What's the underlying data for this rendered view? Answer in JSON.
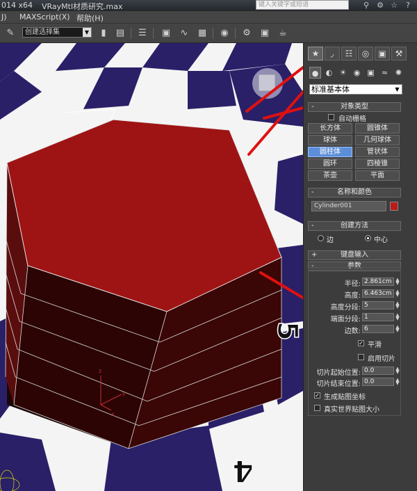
{
  "titlebar": {
    "version_text": "014 x64",
    "file_name": "VRayMtl材质研究.max",
    "search_placeholder": "键入关键字或短语",
    "icons": [
      "binoculars-icon",
      "key-icon",
      "star-icon",
      "help-icon"
    ]
  },
  "menubar": {
    "items": [
      "J)",
      "MAXScript(X)",
      "帮助(H)"
    ]
  },
  "toolbar": {
    "selection_set": "创建选择集",
    "icons": [
      "text-abc-icon",
      "mirror-icon",
      "align-icon",
      "layer-icon",
      "ribbon-icon",
      "curve-editor-icon",
      "schematic-icon",
      "material-editor-icon",
      "render-setup-icon",
      "render-frame-icon",
      "render-icon"
    ]
  },
  "panel": {
    "tabs": [
      "create-tab",
      "modify-tab",
      "hierarchy-tab",
      "motion-tab",
      "display-tab",
      "utilities-tab"
    ],
    "subtabs": [
      "geometry-icon",
      "shapes-icon",
      "lights-icon",
      "cameras-icon",
      "helpers-icon",
      "spacewarps-icon",
      "systems-icon"
    ],
    "primitive_type": "标准基本体",
    "object_type": {
      "title": "对象类型",
      "autogrid": "自动栅格",
      "buttons": [
        "长方体",
        "圆锥体",
        "球体",
        "几何球体",
        "圆柱体",
        "管状体",
        "圆环",
        "四棱锥",
        "茶壶",
        "平面"
      ],
      "active": "圆柱体"
    },
    "name_color": {
      "title": "名称和颜色",
      "name": "Cylinder001",
      "color": "#b81c1c"
    },
    "creation_method": {
      "title": "创建方法",
      "options": [
        "边",
        "中心"
      ],
      "selected": "中心"
    },
    "keyboard_entry": {
      "title": "键盘输入"
    },
    "parameters": {
      "title": "参数",
      "radius_label": "半径:",
      "radius": "2.861cm",
      "height_label": "高度:",
      "height": "6.463cm",
      "height_segments_label": "高度分段:",
      "height_segments": "5",
      "cap_segments_label": "端面分段:",
      "cap_segments": "1",
      "sides_label": "边数:",
      "sides": "6",
      "smooth_label": "平滑",
      "smooth": true,
      "slice_on_label": "启用切片",
      "slice_on": false,
      "slice_from_label": "切片起始位置:",
      "slice_from": "0.0",
      "slice_to_label": "切片结束位置:",
      "slice_to": "0.0",
      "gen_mapping_label": "生成贴图坐标",
      "gen_mapping": true,
      "real_world_label": "真实世界贴图大小",
      "real_world": false
    }
  },
  "viewport": {
    "floor_numbers": [
      "5",
      "4"
    ],
    "object_color": "#9e1414",
    "tile_dark": "#2a2068",
    "tile_light": "#f4f4f4",
    "annotation_color": "#e01010"
  }
}
